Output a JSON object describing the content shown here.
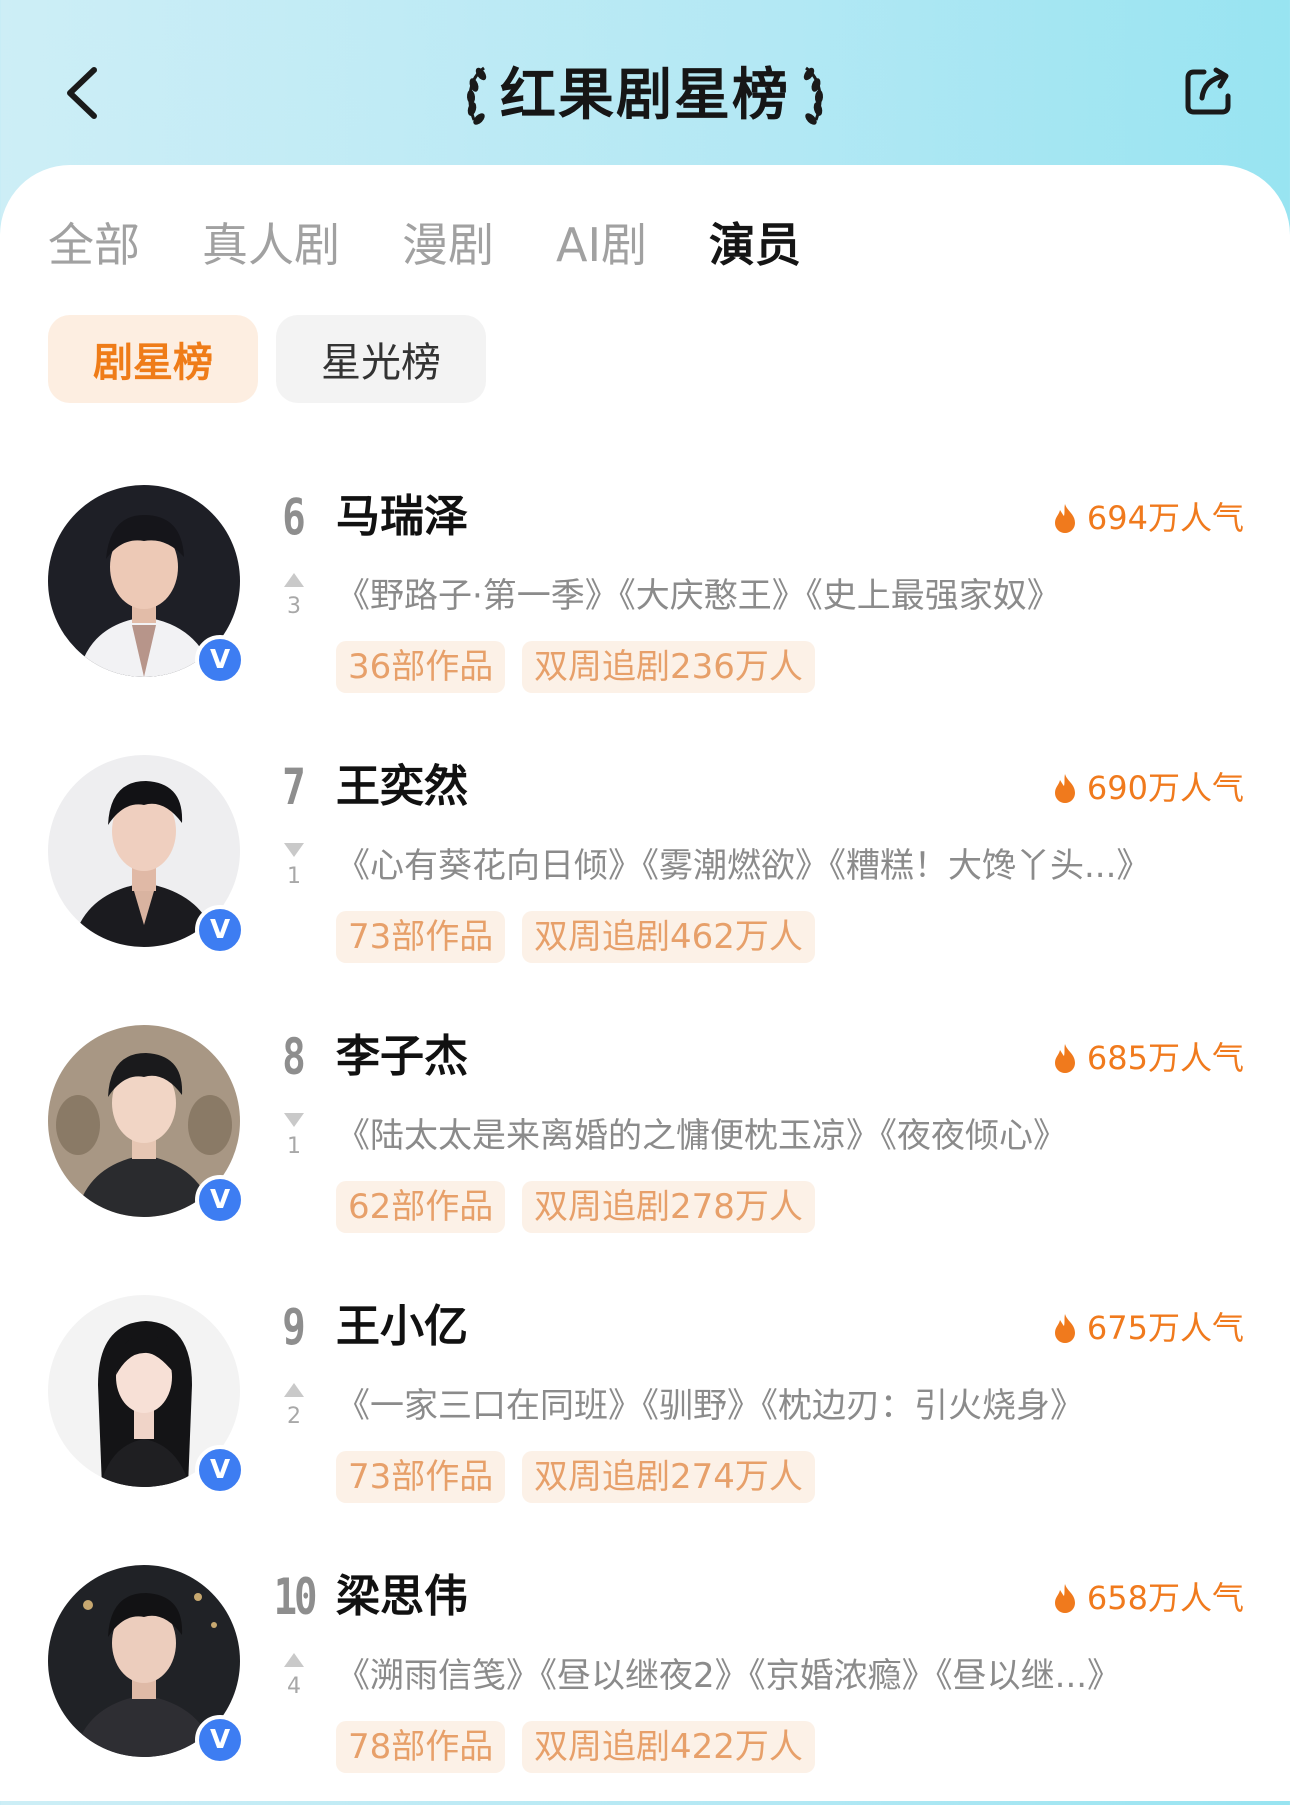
{
  "header": {
    "title": "红果剧星榜",
    "back_icon": "chevron-left-icon",
    "share_icon": "share-icon"
  },
  "tabs": [
    {
      "label": "全部",
      "active": false
    },
    {
      "label": "真人剧",
      "active": false
    },
    {
      "label": "漫剧",
      "active": false
    },
    {
      "label": "AI剧",
      "active": false
    },
    {
      "label": "演员",
      "active": true
    }
  ],
  "subtabs": [
    {
      "label": "剧星榜",
      "active": true
    },
    {
      "label": "星光榜",
      "active": false
    }
  ],
  "colors": {
    "accent": "#f07a1d",
    "active_pill_bg": "#fdeee1",
    "tag_bg": "#fcf1e7",
    "tag_text": "#e7a06a",
    "verified_badge": "#3d7df2",
    "header_gradient_start": "#cdeef6",
    "header_gradient_end": "#98e4f1"
  },
  "actors": [
    {
      "rank": "6",
      "name": "马瑞泽",
      "trend": "up",
      "trend_value": "3",
      "popularity": "694万人气",
      "works": "《野路子·第一季》《大庆憨王》《史上最强家奴》",
      "works_count": "36部作品",
      "followers": "双周追剧236万人",
      "verified_badge": "V"
    },
    {
      "rank": "7",
      "name": "王奕然",
      "trend": "down",
      "trend_value": "1",
      "popularity": "690万人气",
      "works": "《心有葵花向日倾》《雾潮燃欲》《糟糕！大馋丫头...》",
      "works_count": "73部作品",
      "followers": "双周追剧462万人",
      "verified_badge": "V"
    },
    {
      "rank": "8",
      "name": "李子杰",
      "trend": "down",
      "trend_value": "1",
      "popularity": "685万人气",
      "works": "《陆太太是来离婚的之慵便枕玉凉》《夜夜倾心》",
      "works_count": "62部作品",
      "followers": "双周追剧278万人",
      "verified_badge": "V"
    },
    {
      "rank": "9",
      "name": "王小亿",
      "trend": "up",
      "trend_value": "2",
      "popularity": "675万人气",
      "works": "《一家三口在同班》《驯野》《枕边刃：引火烧身》",
      "works_count": "73部作品",
      "followers": "双周追剧274万人",
      "verified_badge": "V"
    },
    {
      "rank": "10",
      "name": "梁思伟",
      "trend": "up",
      "trend_value": "4",
      "popularity": "658万人气",
      "works": "《溯雨信笺》《昼以继夜2》《京婚浓瘾》《昼以继...》",
      "works_count": "78部作品",
      "followers": "双周追剧422万人",
      "verified_badge": "V"
    }
  ]
}
